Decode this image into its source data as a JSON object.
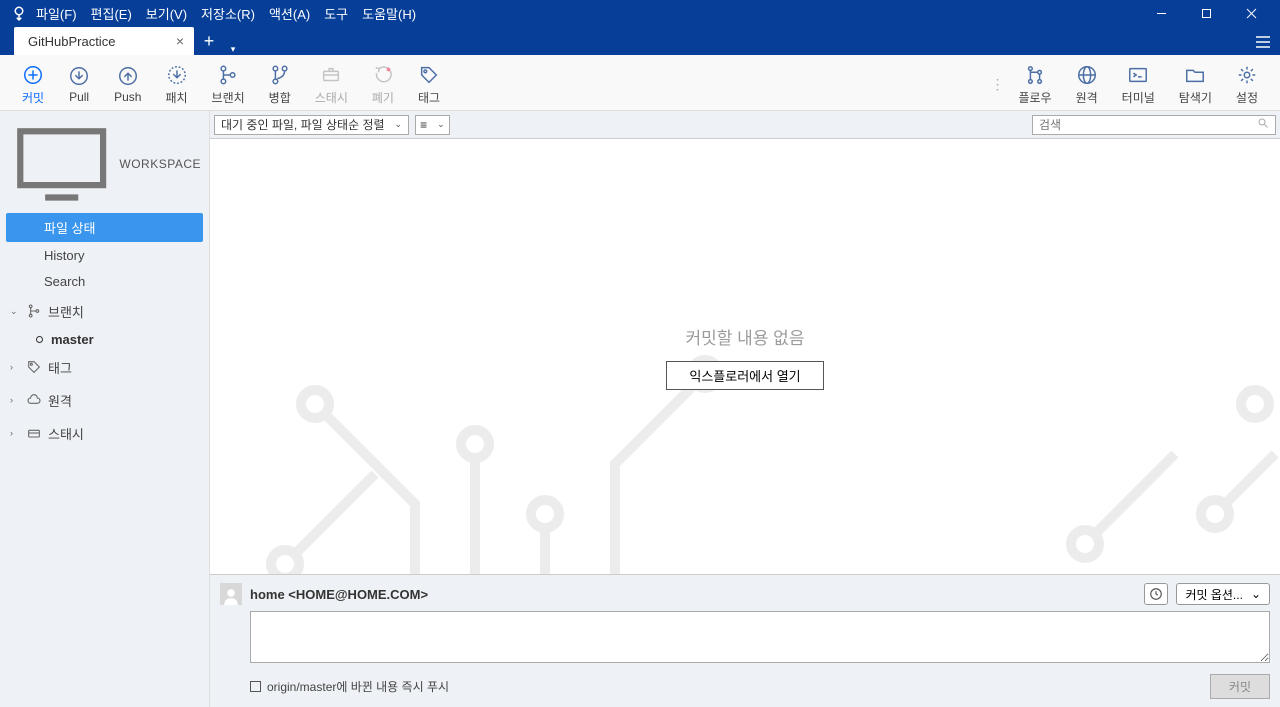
{
  "menu": {
    "file": "파일(F)",
    "edit": "편집(E)",
    "view": "보기(V)",
    "repo": "저장소(R)",
    "action": "액션(A)",
    "tool": "도구",
    "help": "도움말(H)"
  },
  "tab": {
    "title": "GitHubPractice"
  },
  "toolbar": {
    "commit": "커밋",
    "pull": "Pull",
    "push": "Push",
    "patch": "패치",
    "branch": "브랜치",
    "merge": "병합",
    "stash": "스태시",
    "discard": "폐기",
    "tag": "태그",
    "flow": "플로우",
    "remote": "원격",
    "terminal": "터미널",
    "explorer": "탐색기",
    "settings": "설정"
  },
  "sidebar": {
    "workspace": "WORKSPACE",
    "items": {
      "file_status": "파일 상태",
      "history": "History",
      "search": "Search"
    },
    "groups": {
      "branch": "브랜치",
      "tag": "태그",
      "remote": "원격",
      "stash": "스태시"
    },
    "branch_master": "master"
  },
  "filter": {
    "pending": "대기 중인 파일, 파일 상태순 정렬",
    "search_ph": "검색"
  },
  "stage": {
    "empty": "커밋할 내용 없음",
    "open": "익스플로러에서 열기"
  },
  "commit": {
    "author": "home <HOME@HOME.COM>",
    "options": "커밋 옵션...",
    "push_immediately": "origin/master에 바뀐 내용 즉시 푸시",
    "button": "커밋"
  }
}
